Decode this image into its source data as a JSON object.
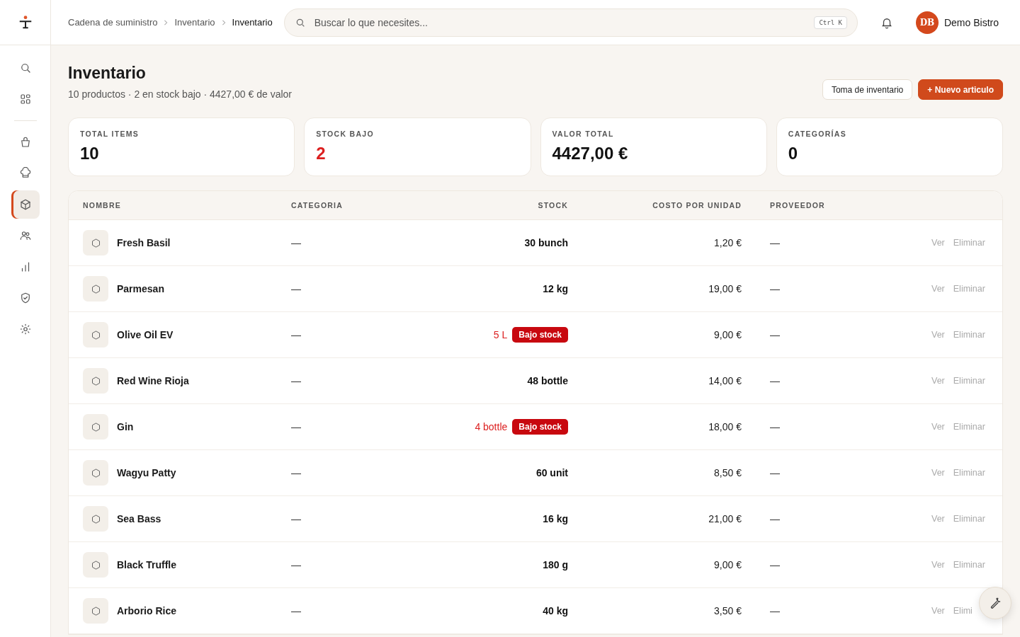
{
  "topbar": {
    "breadcrumbs": [
      {
        "label": "Cadena de suministro",
        "current": false
      },
      {
        "label": "Inventario",
        "current": false
      },
      {
        "label": "Inventario",
        "current": true
      }
    ],
    "search": {
      "placeholder": "Buscar lo que necesites...",
      "shortcut": "Ctrl K"
    },
    "user": {
      "initials": "DB",
      "name": "Demo Bistro"
    }
  },
  "sidebar": {
    "items": [
      {
        "selected": false
      },
      {
        "selected": false
      },
      {
        "selected": false
      },
      {
        "selected": false
      },
      {
        "selected": true
      },
      {
        "selected": false
      },
      {
        "selected": false
      },
      {
        "selected": false
      },
      {
        "selected": false
      }
    ]
  },
  "page": {
    "title": "Inventario",
    "subtitle": "10 productos · 2 en stock bajo · 4427,00 € de valor",
    "buttons": [
      {
        "label": "Toma de inventario",
        "kind": "secondary"
      },
      {
        "label": "+ Nuevo articulo",
        "kind": "primary"
      }
    ]
  },
  "stats": [
    {
      "label": "TOTAL ITEMS",
      "value": "10",
      "alert": false
    },
    {
      "label": "STOCK BAJO",
      "value": "2",
      "alert": true
    },
    {
      "label": "VALOR TOTAL",
      "value": "4427,00 €",
      "alert": false
    },
    {
      "label": "CATEGORÍAS",
      "value": "0",
      "alert": false
    }
  ],
  "table": {
    "columns": [
      "NOMBRE",
      "CATEGORIA",
      "STOCK",
      "COSTO POR UNIDAD",
      "PROVEEDOR"
    ],
    "rows": [
      {
        "name": "Fresh Basil",
        "category": "—",
        "stock": "30 bunch",
        "low": false,
        "cost": "1,20 €",
        "supplier": "—",
        "actions": [
          "Ver",
          "Eliminar"
        ]
      },
      {
        "name": "Parmesan",
        "category": "—",
        "stock": "12 kg",
        "low": false,
        "cost": "19,00 €",
        "supplier": "—",
        "actions": [
          "Ver",
          "Eliminar"
        ]
      },
      {
        "name": "Olive Oil EV",
        "category": "—",
        "stock": "5 L",
        "low": true,
        "badge": "Bajo stock",
        "cost": "9,00 €",
        "supplier": "—",
        "actions": [
          "Ver",
          "Eliminar"
        ]
      },
      {
        "name": "Red Wine Rioja",
        "category": "—",
        "stock": "48 bottle",
        "low": false,
        "cost": "14,00 €",
        "supplier": "—",
        "actions": [
          "Ver",
          "Eliminar"
        ]
      },
      {
        "name": "Gin",
        "category": "—",
        "stock": "4 bottle",
        "low": true,
        "badge": "Bajo stock",
        "cost": "18,00 €",
        "supplier": "—",
        "actions": [
          "Ver",
          "Eliminar"
        ]
      },
      {
        "name": "Wagyu Patty",
        "category": "—",
        "stock": "60 unit",
        "low": false,
        "cost": "8,50 €",
        "supplier": "—",
        "actions": [
          "Ver",
          "Eliminar"
        ]
      },
      {
        "name": "Sea Bass",
        "category": "—",
        "stock": "16 kg",
        "low": false,
        "cost": "21,00 €",
        "supplier": "—",
        "actions": [
          "Ver",
          "Eliminar"
        ]
      },
      {
        "name": "Black Truffle",
        "category": "—",
        "stock": "180 g",
        "low": false,
        "cost": "9,00 €",
        "supplier": "—",
        "actions": [
          "Ver",
          "Eliminar"
        ]
      },
      {
        "name": "Arborio Rice",
        "category": "—",
        "stock": "40 kg",
        "low": false,
        "cost": "3,50 €",
        "supplier": "—",
        "actions": [
          "Ver",
          "Elimi"
        ]
      }
    ]
  }
}
